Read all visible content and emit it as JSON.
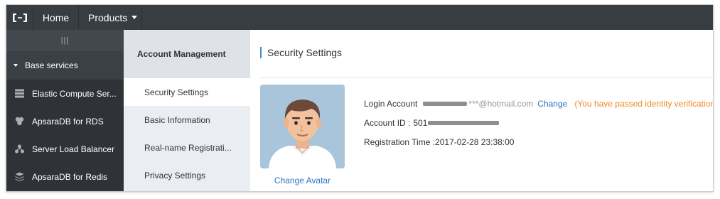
{
  "topbar": {
    "logo_icon": "alibaba-cloud-logo-icon",
    "home_label": "Home",
    "products_label": "Products"
  },
  "sidebar": {
    "handle_label": "|||",
    "group_label": "Base services",
    "items": [
      {
        "label": "Elastic Compute Ser...",
        "icon": "server-icon"
      },
      {
        "label": "ApsaraDB for RDS",
        "icon": "database-icon"
      },
      {
        "label": "Server Load Balancer",
        "icon": "load-balancer-icon"
      },
      {
        "label": "ApsaraDB for Redis",
        "icon": "redis-icon"
      }
    ]
  },
  "subnav": {
    "title": "Account Management",
    "items": [
      {
        "label": "Security Settings",
        "active": true
      },
      {
        "label": "Basic Information",
        "active": false
      },
      {
        "label": "Real-name Registrati...",
        "active": false
      },
      {
        "label": "Privacy Settings",
        "active": false
      }
    ]
  },
  "main": {
    "title": "Security Settings",
    "change_avatar_label": "Change Avatar",
    "login_account_label": "Login Account",
    "login_account_value_suffix": "***@hotmail.com",
    "change_label": "Change",
    "verification_text": "(You have passed identity verification)",
    "account_id_label": "Account ID :",
    "account_id_prefix": "501",
    "registration_time_label": "Registration Time :",
    "registration_time_value": "2017-02-28 23:38:00"
  },
  "colors": {
    "topbar_bg": "#373d41",
    "sidebar_bg": "#2f3337",
    "link": "#2a74c2",
    "verified": "#f08a24",
    "accent": "#3d8fd1"
  }
}
